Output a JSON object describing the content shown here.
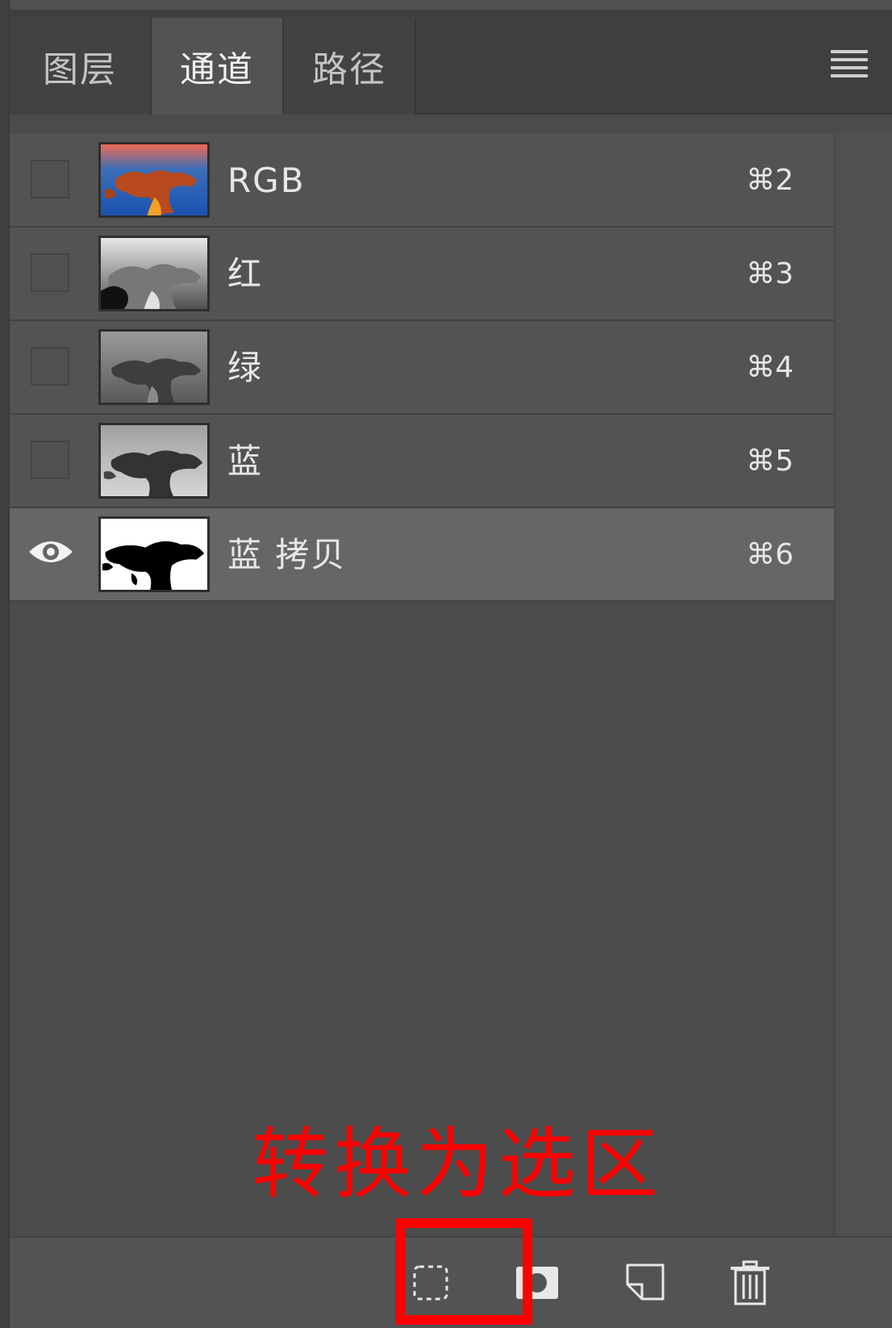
{
  "tabs": [
    {
      "label": "图层",
      "active": false
    },
    {
      "label": "通道",
      "active": true
    },
    {
      "label": "路径",
      "active": false
    }
  ],
  "channels": [
    {
      "name": "RGB",
      "shortcut": "⌘2",
      "visible": false,
      "selected": false,
      "thumb": "color"
    },
    {
      "name": "红",
      "shortcut": "⌘3",
      "visible": false,
      "selected": false,
      "thumb": "gray-red"
    },
    {
      "name": "绿",
      "shortcut": "⌘4",
      "visible": false,
      "selected": false,
      "thumb": "gray-green"
    },
    {
      "name": "蓝",
      "shortcut": "⌘5",
      "visible": false,
      "selected": false,
      "thumb": "gray-blue"
    },
    {
      "name": "蓝 拷贝",
      "shortcut": "⌘6",
      "visible": true,
      "selected": true,
      "thumb": "mask"
    }
  ],
  "annotation": {
    "text": "转换为选区",
    "color": "#ff0000"
  },
  "colors": {
    "panel_bg": "#4b4b4b",
    "row_bg": "#535353",
    "row_selected_bg": "#666666",
    "annotation": "#ff0000"
  },
  "toolbar": {
    "icons": [
      "load-selection-icon",
      "save-mask-icon",
      "new-channel-icon",
      "trash-icon"
    ]
  }
}
